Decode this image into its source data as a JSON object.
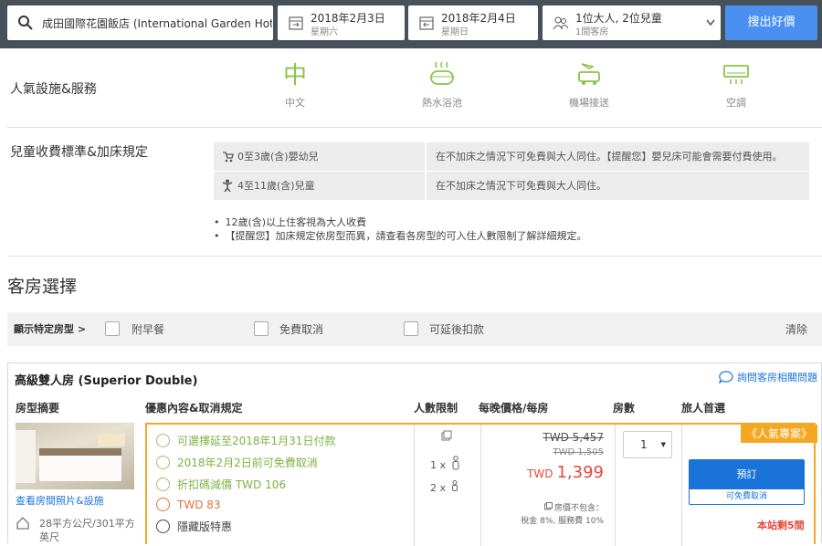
{
  "search": {
    "hotel": "成田國際花園飯店 (International Garden Hot...",
    "checkin_date": "2018年2月3日",
    "checkin_day": "星期六",
    "checkout_date": "2018年2月4日",
    "checkout_day": "星期日",
    "guests": "1位大人, 2位兒童",
    "rooms": "1間客房",
    "search_button": "搜出好價"
  },
  "facilities": {
    "title": "人氣設施&服務",
    "items": [
      {
        "label": "中文",
        "icon": "chinese-char-icon"
      },
      {
        "label": "熱水浴池",
        "icon": "hot-tub-icon"
      },
      {
        "label": "機場接送",
        "icon": "airport-shuttle-icon"
      },
      {
        "label": "空調",
        "icon": "air-conditioner-icon"
      }
    ]
  },
  "children_policy": {
    "title": "兒童收費標準&加床規定",
    "rows": [
      {
        "age": "0至3歲(含)嬰幼兒",
        "rule": "在不加床之情況下可免費與大人同住。【提醒您】嬰兒床可能會需要付費使用。"
      },
      {
        "age": "4至11歲(含)兒童",
        "rule": "在不加床之情況下可免費與大人同住。"
      }
    ],
    "notes": [
      "12歲(含)以上住客視為大人收費",
      "【提醒您】加床規定依房型而異，請查看各房型的可入住人數限制了解詳細規定。"
    ]
  },
  "rooms_section": {
    "title": "客房選擇",
    "filter_label": "顯示特定房型 >",
    "filters": [
      "附早餐",
      "免費取消",
      "可延後扣款"
    ],
    "clear": "清除"
  },
  "room": {
    "name": "高級雙人房 (Superior Double)",
    "ask_link": "詢問客房相關問題",
    "columns": [
      "房型摘要",
      "優惠內容&取消規定",
      "人數限制",
      "每晚價格/每房",
      "房數",
      "旅人首選"
    ],
    "photos_link": "查看房間照片&設施",
    "size": "28平方公尺/301平方英尺",
    "perks": [
      {
        "text": "可選擇延至2018年1月31日付款",
        "color": "#7cb342"
      },
      {
        "text": "2018年2月2日前可免費取消",
        "color": "#7cb342"
      },
      {
        "text": "折扣碼減價 TWD 106",
        "color": "#7cb342"
      },
      {
        "text": "TWD 83",
        "color": "#e0733a"
      },
      {
        "text": "隱藏版特惠",
        "color": "#444444"
      }
    ],
    "occupancy": [
      "1 x",
      "2 x"
    ],
    "price_original": "TWD 5,457",
    "price_second": "TWD 1,505",
    "price_currency": "TWD",
    "price_final": "1,399",
    "price_note_1": "房價不包含：",
    "price_note_2": "稅金 8%, 服務費 10%",
    "rooms_select": "1",
    "badge": "《人氣專案》",
    "book_button": "預訂",
    "book_sub": "可免費取消",
    "left": "本站剩5間"
  },
  "colors": {
    "topbar": "#475159",
    "search_button": "#4a90f0",
    "accent_orange": "#f3a823",
    "price_red": "#e8463a",
    "book_blue": "#1a73d9"
  }
}
